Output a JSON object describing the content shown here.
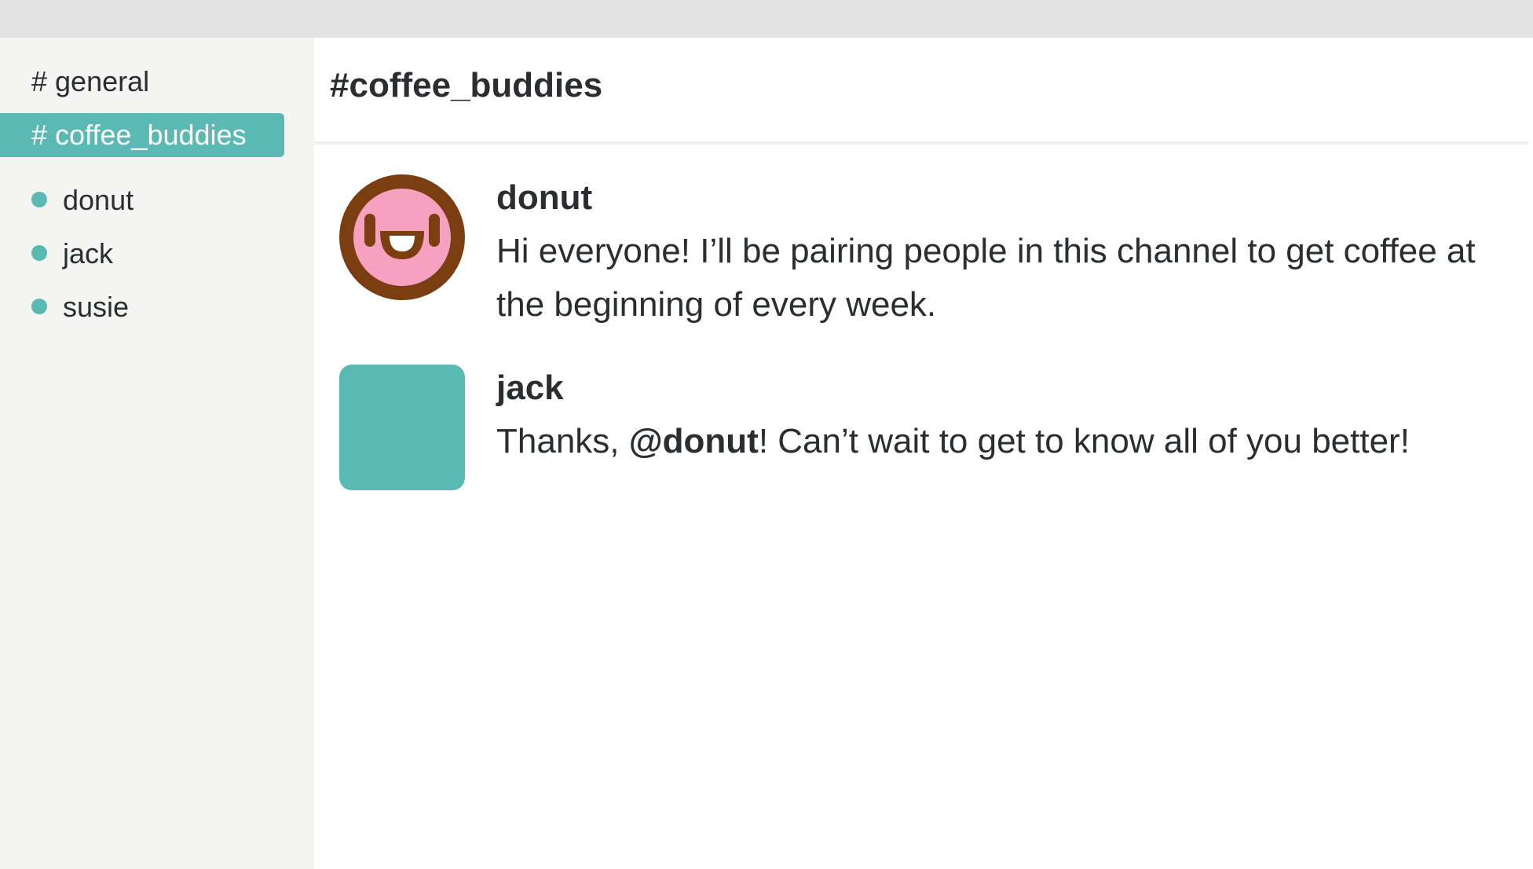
{
  "sidebar": {
    "channels": [
      {
        "label": "# general",
        "active": false
      },
      {
        "label": "# coffee_buddies",
        "active": true
      }
    ],
    "users": [
      {
        "name": "donut",
        "status_color": "#5abab3"
      },
      {
        "name": "jack",
        "status_color": "#5abab3"
      },
      {
        "name": "susie",
        "status_color": "#5abab3"
      }
    ]
  },
  "main": {
    "channel_title": "#coffee_buddies",
    "messages": [
      {
        "author": "donut",
        "avatar_icon": "donut-face-icon",
        "text": "Hi everyone! I’ll be pairing people in this channel to get coffee at the beginning of every week."
      },
      {
        "author": "jack",
        "avatar_icon": "square-avatar",
        "text_before": "Thanks, ",
        "mention": "@donut",
        "text_after": "! Can’t wait to get to know all of you better!"
      }
    ]
  },
  "colors": {
    "accent": "#5abab3",
    "donut_brown": "#7a3e10",
    "donut_pink": "#f7a1c0"
  }
}
